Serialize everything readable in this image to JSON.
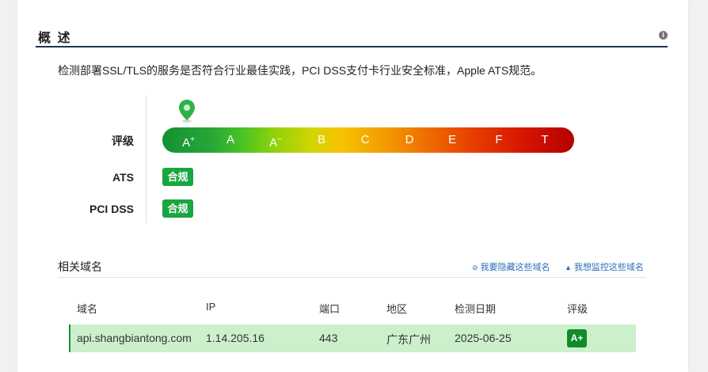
{
  "overview": {
    "title": "概 述",
    "info_icon": "i",
    "description": "检测部署SSL/TLS的服务是否符合行业最佳实践，PCI DSS支付卡行业安全标准，Apple ATS规范。"
  },
  "rating": {
    "label": "评级",
    "current_grade": "A+",
    "grades": [
      {
        "base": "A",
        "mod": "+"
      },
      {
        "base": "A",
        "mod": ""
      },
      {
        "base": "A",
        "mod": "−"
      },
      {
        "base": "B",
        "mod": ""
      },
      {
        "base": "C",
        "mod": ""
      },
      {
        "base": "D",
        "mod": ""
      },
      {
        "base": "E",
        "mod": ""
      },
      {
        "base": "F",
        "mod": ""
      },
      {
        "base": "T",
        "mod": ""
      }
    ]
  },
  "ats": {
    "label": "ATS",
    "status": "合规"
  },
  "pci": {
    "label": "PCI DSS",
    "status": "合规"
  },
  "related": {
    "title": "相关域名",
    "hide_link": "我要隐藏这些域名",
    "monitor_link": "我想监控这些域名",
    "hide_icon": "eye-slash-icon",
    "monitor_icon": "bell-icon"
  },
  "table": {
    "headers": [
      "域名",
      "IP",
      "端口",
      "地区",
      "检测日期",
      "评级"
    ],
    "rows": [
      {
        "domain": "api.shangbiantong.com",
        "ip": "1.14.205.16",
        "port": "443",
        "region": "广东广州",
        "date": "2025-06-25",
        "grade": "A+"
      }
    ]
  },
  "colors": {
    "header_rule": "#1f3355",
    "compliant_badge": "#18a640",
    "row_highlight": "#ccf0cc",
    "link": "#2a6db5"
  }
}
